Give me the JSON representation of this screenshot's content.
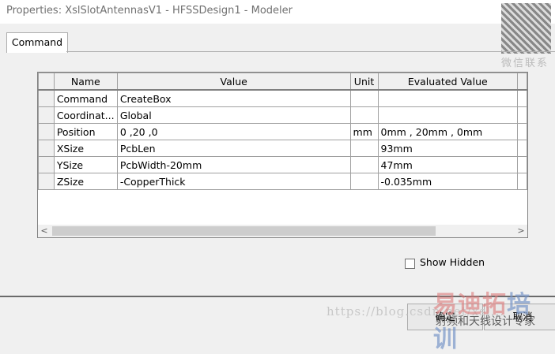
{
  "window": {
    "title": "Properties: XslSlotAntennasV1 - HFSSDesign1 - Modeler"
  },
  "tabs": [
    {
      "label": "Command"
    }
  ],
  "grid": {
    "columns": [
      "Name",
      "Value",
      "Unit",
      "Evaluated Value"
    ],
    "rows": [
      {
        "name": "Command",
        "value": "CreateBox",
        "unit": "",
        "evaluated": ""
      },
      {
        "name": "Coordinat...",
        "value": "Global",
        "unit": "",
        "evaluated": ""
      },
      {
        "name": "Position",
        "value": "0 ,20 ,0",
        "unit": "mm",
        "evaluated": "0mm , 20mm , 0mm"
      },
      {
        "name": "XSize",
        "value": "PcbLen",
        "unit": "",
        "evaluated": "93mm"
      },
      {
        "name": "YSize",
        "value": "PcbWidth-20mm",
        "unit": "",
        "evaluated": "47mm"
      },
      {
        "name": "ZSize",
        "value": "-CopperThick",
        "unit": "",
        "evaluated": "-0.035mm"
      }
    ]
  },
  "show_hidden": {
    "label": "Show Hidden",
    "checked": false
  },
  "buttons": {
    "ok": "确定",
    "cancel": "取消"
  },
  "watermark": {
    "url": "https://blog.csdn.net/xsl...",
    "brand_a": "易迪拓",
    "brand_b": "培训",
    "subtitle": "射频和天线设计专家",
    "qr_label": "微信联系"
  }
}
